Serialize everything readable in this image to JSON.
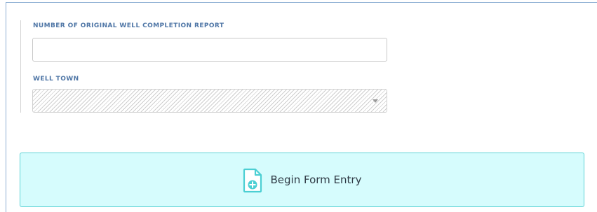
{
  "form": {
    "report_number": {
      "label": "NUMBER OF ORIGINAL WELL COMPLETION REPORT",
      "value": ""
    },
    "well_town": {
      "label": "WELL TOWN",
      "value": ""
    }
  },
  "actions": {
    "begin_label": "Begin Form Entry",
    "begin_icon": "add-document-icon"
  },
  "colors": {
    "label": "#4f76a6",
    "button_bg": "#d6fcfd",
    "button_border": "#5fd3d6"
  }
}
